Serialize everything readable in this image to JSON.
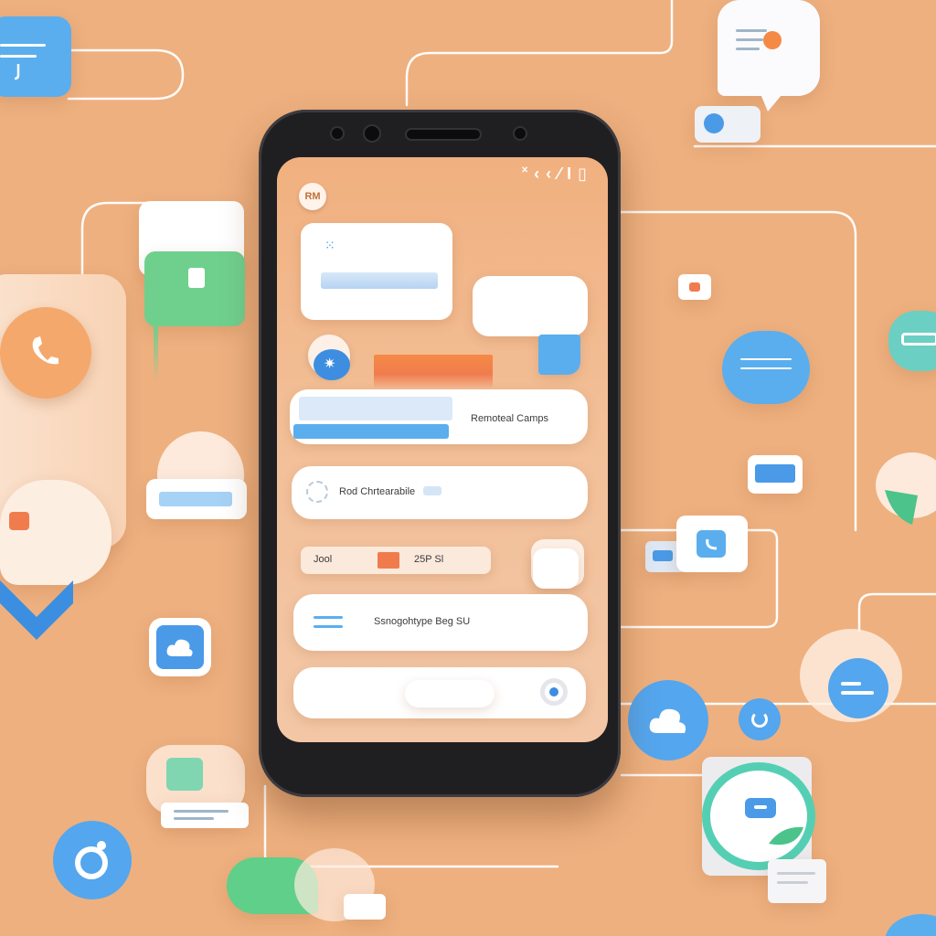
{
  "colors": {
    "background": "#eeb07f",
    "accent_blue": "#5aaeee",
    "accent_orange": "#f07c4e",
    "accent_green": "#6fd08e",
    "phone_body": "#1f1f22"
  },
  "phone": {
    "status_bar": {
      "text": "˟ ‹ ‹ ⁄ I ▯"
    },
    "avatar": {
      "text": "RM"
    },
    "rows": [
      {
        "text": "Remoteal Camps"
      },
      {
        "text": "Rod Chrtearabile"
      },
      {
        "text_left": "Jool",
        "text_right": "25P Sl"
      },
      {
        "text": "Ssnogohtype Beg SU"
      }
    ]
  },
  "icons": [
    "phone-icon",
    "chat-bubble-icon",
    "cloud-icon",
    "message-icon",
    "play-icon",
    "ring-icon",
    "link-icon",
    "bot-icon"
  ]
}
